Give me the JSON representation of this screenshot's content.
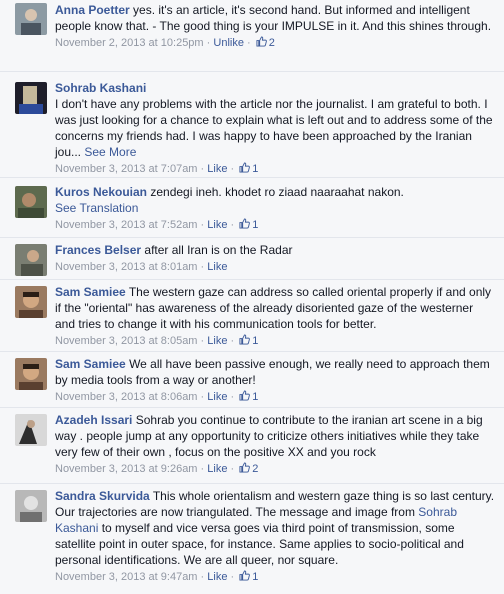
{
  "comments": [
    {
      "author": "Anna Poetter",
      "text": "yes. it's an article, it's second hand. But informed and intelligent people know that. - The good thing is your IMPULSE in it. And this shines through.",
      "timestamp": "November 2, 2013 at 10:25pm",
      "action": "Unlike",
      "likes": "2",
      "avatar_color": "#7a8a95"
    },
    {
      "author": "Sohrab Kashani",
      "text": "I don't have any problems with the article nor the journalist. I am grateful to both. I was just looking for a chance to explain what is left out and to address some of the concerns my friends had. I was happy to have been approached by the Iranian jou...",
      "see_more": "See More",
      "timestamp": "November 3, 2013 at 7:07am",
      "action": "Like",
      "likes": "1",
      "avatar_color": "#2a2a3a"
    },
    {
      "author": "Kuros Nekouian",
      "text": "zendegi ineh. khodet ro ziaad naaraahat nakon.",
      "see_translation": "See Translation",
      "timestamp": "November 3, 2013 at 7:52am",
      "action": "Like",
      "likes": "1",
      "avatar_color": "#5a6a4a"
    },
    {
      "author": "Frances Belser",
      "text": "after all Iran is on the Radar",
      "timestamp": "November 3, 2013 at 8:01am",
      "action": "Like",
      "likes": "",
      "avatar_color": "#6b6f66"
    },
    {
      "author": "Sam Samiee",
      "text": "The western gaze can address so called oriental properly if and only if the \"oriental\" has awareness of the already disoriented gaze of the westerner and tries to change it with his communication tools for better.",
      "timestamp": "November 3, 2013 at 8:05am",
      "action": "Like",
      "likes": "1",
      "avatar_color": "#8a6a50"
    },
    {
      "author": "Sam Samiee",
      "text": "We all have been passive enough, we really need to approach them by media tools from a way or another!",
      "timestamp": "November 3, 2013 at 8:06am",
      "action": "Like",
      "likes": "1",
      "avatar_color": "#8a6a50"
    },
    {
      "author": "Azadeh Issari",
      "text": "Sohrab you continue to contribute to the iranian art scene in a big way . people jump at any opportunity to criticize others initiatives while they take very few of their own , focus on the positive XX and you rock",
      "timestamp": "November 3, 2013 at 9:26am",
      "action": "Like",
      "likes": "2",
      "avatar_color": "#3a3a3a"
    },
    {
      "author": "Sandra Skurvida",
      "text_before": "This whole orientalism and western gaze thing is so last century. Our trajectories are now triangulated. The message and image from ",
      "mention": "Sohrab Kashani",
      "text_after": " to myself and vice versa goes via third point of transmission, some satellite point in outer space, for instance. Same applies to socio-political and personal identifications. We are all queer, nor square.",
      "timestamp": "November 3, 2013 at 9:47am",
      "action": "Like",
      "likes": "1",
      "avatar_color": "#9a9a9a"
    }
  ],
  "separator": "·",
  "colors": {
    "link": "#3b5998",
    "meta": "#9197a3",
    "background": "#f6f7f9"
  }
}
